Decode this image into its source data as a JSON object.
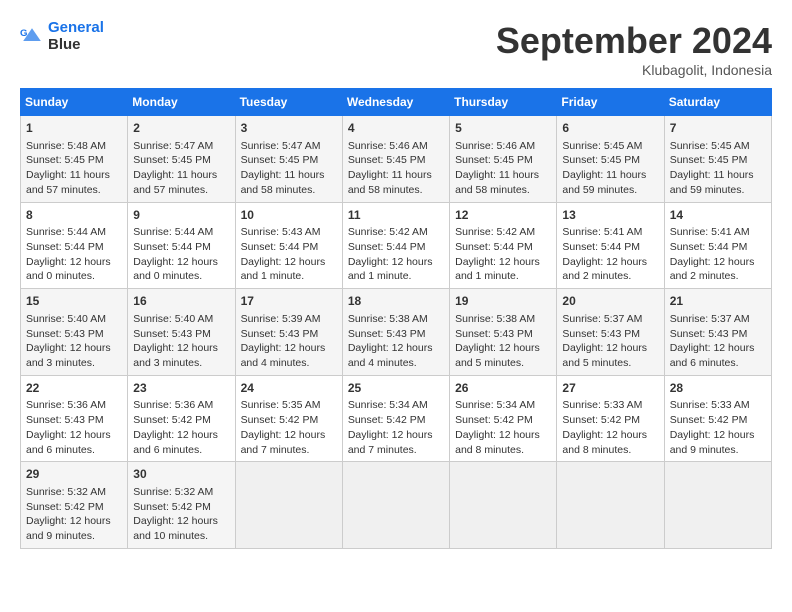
{
  "header": {
    "logo_line1": "General",
    "logo_line2": "Blue",
    "month": "September 2024",
    "location": "Klubagolit, Indonesia"
  },
  "days_of_week": [
    "Sunday",
    "Monday",
    "Tuesday",
    "Wednesday",
    "Thursday",
    "Friday",
    "Saturday"
  ],
  "weeks": [
    [
      {
        "day": "1",
        "lines": [
          "Sunrise: 5:48 AM",
          "Sunset: 5:45 PM",
          "Daylight: 11 hours",
          "and 57 minutes."
        ]
      },
      {
        "day": "2",
        "lines": [
          "Sunrise: 5:47 AM",
          "Sunset: 5:45 PM",
          "Daylight: 11 hours",
          "and 57 minutes."
        ]
      },
      {
        "day": "3",
        "lines": [
          "Sunrise: 5:47 AM",
          "Sunset: 5:45 PM",
          "Daylight: 11 hours",
          "and 58 minutes."
        ]
      },
      {
        "day": "4",
        "lines": [
          "Sunrise: 5:46 AM",
          "Sunset: 5:45 PM",
          "Daylight: 11 hours",
          "and 58 minutes."
        ]
      },
      {
        "day": "5",
        "lines": [
          "Sunrise: 5:46 AM",
          "Sunset: 5:45 PM",
          "Daylight: 11 hours",
          "and 58 minutes."
        ]
      },
      {
        "day": "6",
        "lines": [
          "Sunrise: 5:45 AM",
          "Sunset: 5:45 PM",
          "Daylight: 11 hours",
          "and 59 minutes."
        ]
      },
      {
        "day": "7",
        "lines": [
          "Sunrise: 5:45 AM",
          "Sunset: 5:45 PM",
          "Daylight: 11 hours",
          "and 59 minutes."
        ]
      }
    ],
    [
      {
        "day": "8",
        "lines": [
          "Sunrise: 5:44 AM",
          "Sunset: 5:44 PM",
          "Daylight: 12 hours",
          "and 0 minutes."
        ]
      },
      {
        "day": "9",
        "lines": [
          "Sunrise: 5:44 AM",
          "Sunset: 5:44 PM",
          "Daylight: 12 hours",
          "and 0 minutes."
        ]
      },
      {
        "day": "10",
        "lines": [
          "Sunrise: 5:43 AM",
          "Sunset: 5:44 PM",
          "Daylight: 12 hours",
          "and 1 minute."
        ]
      },
      {
        "day": "11",
        "lines": [
          "Sunrise: 5:42 AM",
          "Sunset: 5:44 PM",
          "Daylight: 12 hours",
          "and 1 minute."
        ]
      },
      {
        "day": "12",
        "lines": [
          "Sunrise: 5:42 AM",
          "Sunset: 5:44 PM",
          "Daylight: 12 hours",
          "and 1 minute."
        ]
      },
      {
        "day": "13",
        "lines": [
          "Sunrise: 5:41 AM",
          "Sunset: 5:44 PM",
          "Daylight: 12 hours",
          "and 2 minutes."
        ]
      },
      {
        "day": "14",
        "lines": [
          "Sunrise: 5:41 AM",
          "Sunset: 5:44 PM",
          "Daylight: 12 hours",
          "and 2 minutes."
        ]
      }
    ],
    [
      {
        "day": "15",
        "lines": [
          "Sunrise: 5:40 AM",
          "Sunset: 5:43 PM",
          "Daylight: 12 hours",
          "and 3 minutes."
        ]
      },
      {
        "day": "16",
        "lines": [
          "Sunrise: 5:40 AM",
          "Sunset: 5:43 PM",
          "Daylight: 12 hours",
          "and 3 minutes."
        ]
      },
      {
        "day": "17",
        "lines": [
          "Sunrise: 5:39 AM",
          "Sunset: 5:43 PM",
          "Daylight: 12 hours",
          "and 4 minutes."
        ]
      },
      {
        "day": "18",
        "lines": [
          "Sunrise: 5:38 AM",
          "Sunset: 5:43 PM",
          "Daylight: 12 hours",
          "and 4 minutes."
        ]
      },
      {
        "day": "19",
        "lines": [
          "Sunrise: 5:38 AM",
          "Sunset: 5:43 PM",
          "Daylight: 12 hours",
          "and 5 minutes."
        ]
      },
      {
        "day": "20",
        "lines": [
          "Sunrise: 5:37 AM",
          "Sunset: 5:43 PM",
          "Daylight: 12 hours",
          "and 5 minutes."
        ]
      },
      {
        "day": "21",
        "lines": [
          "Sunrise: 5:37 AM",
          "Sunset: 5:43 PM",
          "Daylight: 12 hours",
          "and 6 minutes."
        ]
      }
    ],
    [
      {
        "day": "22",
        "lines": [
          "Sunrise: 5:36 AM",
          "Sunset: 5:43 PM",
          "Daylight: 12 hours",
          "and 6 minutes."
        ]
      },
      {
        "day": "23",
        "lines": [
          "Sunrise: 5:36 AM",
          "Sunset: 5:42 PM",
          "Daylight: 12 hours",
          "and 6 minutes."
        ]
      },
      {
        "day": "24",
        "lines": [
          "Sunrise: 5:35 AM",
          "Sunset: 5:42 PM",
          "Daylight: 12 hours",
          "and 7 minutes."
        ]
      },
      {
        "day": "25",
        "lines": [
          "Sunrise: 5:34 AM",
          "Sunset: 5:42 PM",
          "Daylight: 12 hours",
          "and 7 minutes."
        ]
      },
      {
        "day": "26",
        "lines": [
          "Sunrise: 5:34 AM",
          "Sunset: 5:42 PM",
          "Daylight: 12 hours",
          "and 8 minutes."
        ]
      },
      {
        "day": "27",
        "lines": [
          "Sunrise: 5:33 AM",
          "Sunset: 5:42 PM",
          "Daylight: 12 hours",
          "and 8 minutes."
        ]
      },
      {
        "day": "28",
        "lines": [
          "Sunrise: 5:33 AM",
          "Sunset: 5:42 PM",
          "Daylight: 12 hours",
          "and 9 minutes."
        ]
      }
    ],
    [
      {
        "day": "29",
        "lines": [
          "Sunrise: 5:32 AM",
          "Sunset: 5:42 PM",
          "Daylight: 12 hours",
          "and 9 minutes."
        ]
      },
      {
        "day": "30",
        "lines": [
          "Sunrise: 5:32 AM",
          "Sunset: 5:42 PM",
          "Daylight: 12 hours",
          "and 10 minutes."
        ]
      },
      {
        "day": "",
        "lines": []
      },
      {
        "day": "",
        "lines": []
      },
      {
        "day": "",
        "lines": []
      },
      {
        "day": "",
        "lines": []
      },
      {
        "day": "",
        "lines": []
      }
    ]
  ]
}
